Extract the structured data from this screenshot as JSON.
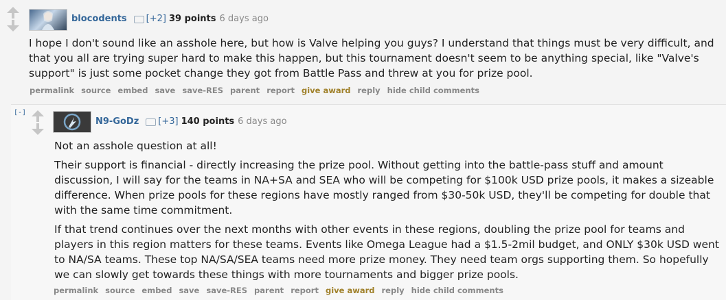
{
  "comments": [
    {
      "author": "blocodents",
      "score_adjust": "[+2]",
      "points": "39 points",
      "time": "6 days ago",
      "paragraphs": [
        "I hope I don't sound like an asshole here, but how is Valve helping you guys? I understand that things must be very difficult, and that you all are trying super hard to make this happen, but this tournament doesn't seem to be anything special, like \"Valve's support\" is just some pocket change they got from Battle Pass and threw at you for prize pool."
      ],
      "buttons": [
        "permalink",
        "source",
        "embed",
        "save",
        "save-RES",
        "parent",
        "report",
        "give award",
        "reply",
        "hide child comments"
      ]
    },
    {
      "collapse": "[-]",
      "author": "N9-GoDz",
      "score_adjust": "[+3]",
      "points": "140 points",
      "time": "6 days ago",
      "paragraphs": [
        "Not an asshole question at all!",
        "Their support is financial - directly increasing the prize pool. Without getting into the battle-pass stuff and amount discussion, I will say for the teams in NA+SA and SEA who will be competing for $100k USD prize pools, it makes a sizeable difference. When prize pools for these regions have mostly ranged from $30-50k USD, they'll be competing for double that with the same time commitment.",
        "If that trend continues over the next months with other events in these regions, doubling the prize pool for teams and players in this region matters for these teams. Events like Omega League had a $1.5-2mil budget, and ONLY $30k USD went to NA/SA teams. These top NA/SA/SEA teams need more prize money. They need team orgs supporting them. So hopefully we can slowly get towards these things with more tournaments and bigger prize pools."
      ],
      "buttons": [
        "permalink",
        "source",
        "embed",
        "save",
        "save-RES",
        "parent",
        "report",
        "give award",
        "reply",
        "hide child comments"
      ]
    }
  ],
  "icons": {
    "upvote": "upvote-arrow-icon",
    "downvote": "downvote-arrow-icon",
    "tag": "user-tag-icon"
  },
  "colors": {
    "author": "#336699",
    "award": "#a0812b",
    "muted": "#888888"
  }
}
